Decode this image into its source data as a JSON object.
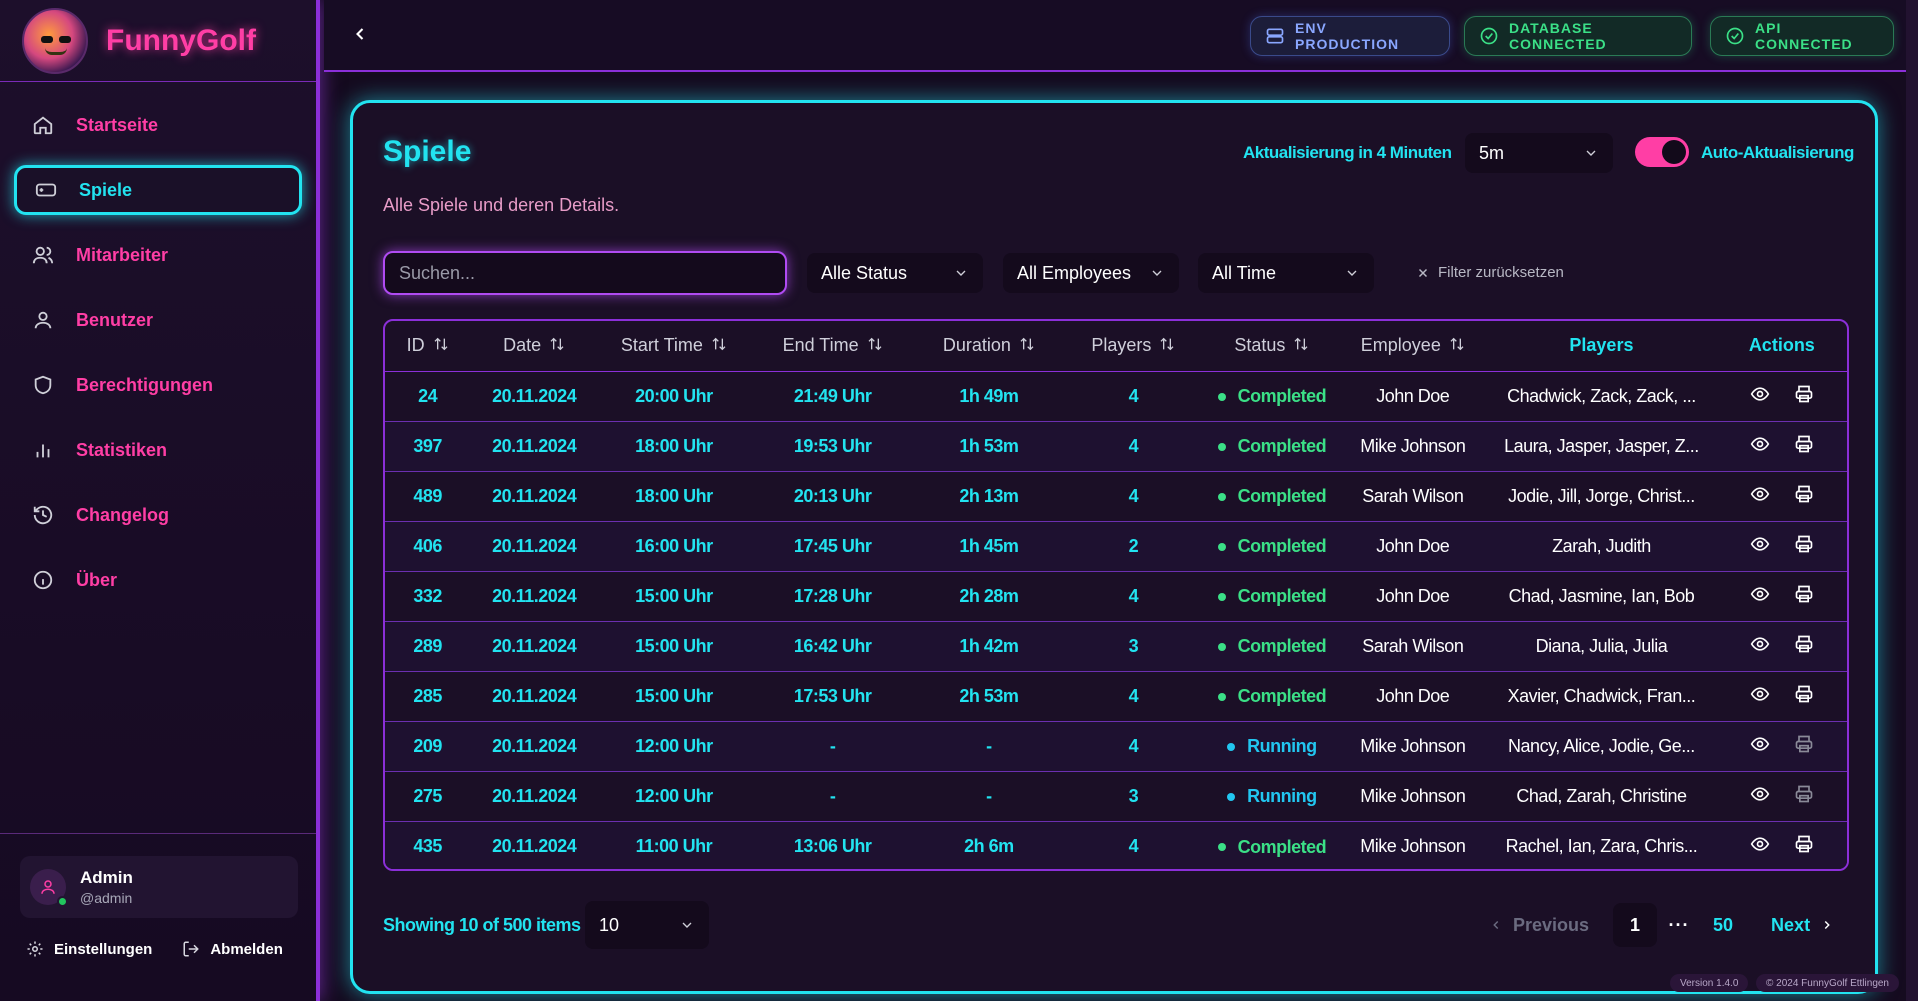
{
  "app": {
    "name": "FunnyGolf"
  },
  "sidebar": {
    "items": [
      {
        "label": "Startseite",
        "icon": "home-icon"
      },
      {
        "label": "Spiele",
        "icon": "gamepad-icon",
        "active": true
      },
      {
        "label": "Mitarbeiter",
        "icon": "users-icon"
      },
      {
        "label": "Benutzer",
        "icon": "user-icon"
      },
      {
        "label": "Berechtigungen",
        "icon": "shield-icon"
      },
      {
        "label": "Statistiken",
        "icon": "bar-chart-icon"
      },
      {
        "label": "Changelog",
        "icon": "history-icon"
      },
      {
        "label": "Über",
        "icon": "info-icon"
      }
    ],
    "user": {
      "name": "Admin",
      "handle": "@admin"
    },
    "settings_label": "Einstellungen",
    "logout_label": "Abmelden"
  },
  "topbar": {
    "env_label": "ENV PRODUCTION",
    "db_label": "DATABASE CONNECTED",
    "api_label": "API CONNECTED"
  },
  "page": {
    "title": "Spiele",
    "subtitle": "Alle Spiele und deren Details.",
    "refresh_text": "Aktualisierung in 4 Minuten",
    "refresh_interval": "5m",
    "auto_refresh_label": "Auto-Aktualisierung",
    "auto_refresh_on": true
  },
  "filters": {
    "search_placeholder": "Suchen...",
    "status": "Alle Status",
    "employee": "All Employees",
    "time": "All Time",
    "reset_label": "Filter zurücksetzen"
  },
  "table": {
    "headers": [
      "ID",
      "Date",
      "Start Time",
      "End Time",
      "Duration",
      "Players",
      "Status",
      "Employee",
      "Players",
      "Actions"
    ],
    "rows": [
      {
        "id": "24",
        "date": "20.11.2024",
        "start": "20:00 Uhr",
        "end": "21:49 Uhr",
        "duration": "1h 49m",
        "players": "4",
        "status": "Completed",
        "employee": "John Doe",
        "names": "Chadwick, Zack, Zack, ..."
      },
      {
        "id": "397",
        "date": "20.11.2024",
        "start": "18:00 Uhr",
        "end": "19:53 Uhr",
        "duration": "1h 53m",
        "players": "4",
        "status": "Completed",
        "employee": "Mike Johnson",
        "names": "Laura, Jasper, Jasper, Z..."
      },
      {
        "id": "489",
        "date": "20.11.2024",
        "start": "18:00 Uhr",
        "end": "20:13 Uhr",
        "duration": "2h 13m",
        "players": "4",
        "status": "Completed",
        "employee": "Sarah Wilson",
        "names": "Jodie, Jill, Jorge, Christ..."
      },
      {
        "id": "406",
        "date": "20.11.2024",
        "start": "16:00 Uhr",
        "end": "17:45 Uhr",
        "duration": "1h 45m",
        "players": "2",
        "status": "Completed",
        "employee": "John Doe",
        "names": "Zarah, Judith"
      },
      {
        "id": "332",
        "date": "20.11.2024",
        "start": "15:00 Uhr",
        "end": "17:28 Uhr",
        "duration": "2h 28m",
        "players": "4",
        "status": "Completed",
        "employee": "John Doe",
        "names": "Chad, Jasmine, Ian, Bob"
      },
      {
        "id": "289",
        "date": "20.11.2024",
        "start": "15:00 Uhr",
        "end": "16:42 Uhr",
        "duration": "1h 42m",
        "players": "3",
        "status": "Completed",
        "employee": "Sarah Wilson",
        "names": "Diana, Julia, Julia"
      },
      {
        "id": "285",
        "date": "20.11.2024",
        "start": "15:00 Uhr",
        "end": "17:53 Uhr",
        "duration": "2h 53m",
        "players": "4",
        "status": "Completed",
        "employee": "John Doe",
        "names": "Xavier, Chadwick, Fran..."
      },
      {
        "id": "209",
        "date": "20.11.2024",
        "start": "12:00 Uhr",
        "end": "-",
        "duration": "-",
        "players": "4",
        "status": "Running",
        "employee": "Mike Johnson",
        "names": "Nancy, Alice, Jodie, Ge..."
      },
      {
        "id": "275",
        "date": "20.11.2024",
        "start": "12:00 Uhr",
        "end": "-",
        "duration": "-",
        "players": "3",
        "status": "Running",
        "employee": "Mike Johnson",
        "names": "Chad, Zarah, Christine"
      },
      {
        "id": "435",
        "date": "20.11.2024",
        "start": "11:00 Uhr",
        "end": "13:06 Uhr",
        "duration": "2h 6m",
        "players": "4",
        "status": "Completed",
        "employee": "Mike Johnson",
        "names": "Rachel, Ian, Zara, Chris..."
      }
    ]
  },
  "footer": {
    "showing": "Showing 10 of 500 items",
    "page_size": "10",
    "previous": "Previous",
    "current_page": "1",
    "ellipsis": "···",
    "last_page": "50",
    "next": "Next"
  },
  "meta_badges": {
    "version": "Version 1.4.0",
    "copyright": "© 2024 FunnyGolf Ettlingen"
  },
  "colors": {
    "accent_cyan": "#22e3f0",
    "accent_pink": "#ff3ea5",
    "accent_purple": "#8b2fd8",
    "status_green": "#3be087"
  }
}
